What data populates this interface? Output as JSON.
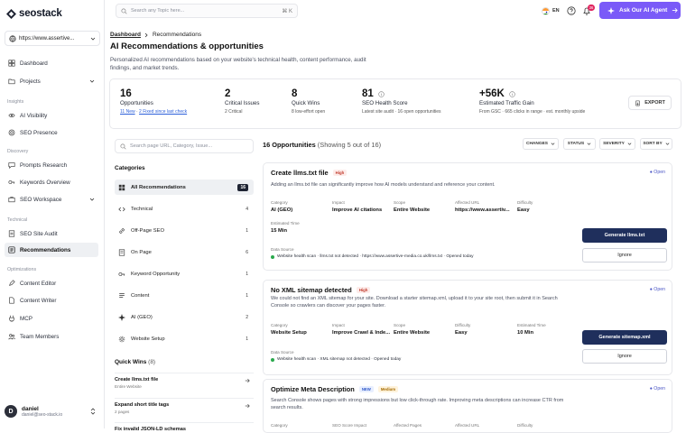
{
  "app": {
    "logo_text": "seostack"
  },
  "sidebar": {
    "site": "https://www.assertive...",
    "items": {
      "dashboard": "Dashboard",
      "projects": "Projects",
      "insights_label": "Insights",
      "ai_visibility": "AI Visibility",
      "seo_presence": "SEO Presence",
      "discovery_label": "Discovery",
      "prompts_research": "Prompts Research",
      "keywords_overview": "Keywords Overview",
      "seo_workspace": "SEO Workspace",
      "technical_label": "Technical",
      "seo_site_audit": "SEO Site Audit",
      "recommendations": "Recommendations",
      "optimizations_label": "Optimizations",
      "content_editor": "Content Editor",
      "content_writer": "Content Writer",
      "mcp": "MCP",
      "team_members": "Team Members"
    },
    "user": {
      "initial": "D",
      "name": "daniel",
      "email": "daniel@seo-stack.io"
    }
  },
  "topbar": {
    "search_placeholder": "Search any Topic here...",
    "shortcut": "⌘ K",
    "lang": "EN",
    "notif_count": "36",
    "ask_label": "Ask Our AI Agent"
  },
  "header": {
    "breadcrumb_root": "Dashboard",
    "breadcrumb_current": "Recommendations",
    "title": "AI Recommendations & opportunities",
    "description": "Personalized AI recommendations based on your website's technical health, content performance, audit findings, and market trends."
  },
  "stats": {
    "opportunities": {
      "value": "16",
      "label": "Opportunities",
      "new": "11 New",
      "fixed": "2 Fixed since last check"
    },
    "critical": {
      "value": "2",
      "label": "Critical Issues",
      "sub": "2 Critical"
    },
    "quick": {
      "value": "8",
      "label": "Quick Wins",
      "sub": "8 low-effort open"
    },
    "health": {
      "value": "81",
      "label": "SEO Health Score",
      "sub": "Latest site audit · 16 open opportunities"
    },
    "traffic": {
      "value": "+56K",
      "label": "Estimated Traffic Gain",
      "sub": "From GSC · 665 clicks in range · est. monthly upside"
    },
    "export_label": "EXPORT"
  },
  "filters": {
    "search_placeholder": "Search page URL, Category, Issue...",
    "categories_title": "Categories",
    "categories": [
      {
        "label": "All Recommendations",
        "count": "16"
      },
      {
        "label": "Technical",
        "count": "4"
      },
      {
        "label": "Off-Page SEO",
        "count": "1"
      },
      {
        "label": "On Page",
        "count": "6"
      },
      {
        "label": "Keyword Opportunity",
        "count": "1"
      },
      {
        "label": "Content",
        "count": "1"
      },
      {
        "label": "AI (GEO)",
        "count": "2"
      },
      {
        "label": "Website Setup",
        "count": "1"
      }
    ],
    "quick_wins_title": "Quick Wins",
    "quick_wins_count": "(8)",
    "quick_wins": [
      {
        "title": "Create llms.txt file",
        "sub": "Entire Website"
      },
      {
        "title": "Expand short title tags",
        "sub": "2 pages"
      },
      {
        "title": "Fix invalid JSON-LD schemas",
        "sub": ""
      }
    ]
  },
  "list": {
    "count_label": "16 Opportunities",
    "showing": "(Showing 5 out of 16)",
    "changes": "CHANGES",
    "status": "STATUS",
    "severity": "SEVERITY",
    "sort": "SORT BY"
  },
  "cards": [
    {
      "title": "Create llms.txt file",
      "badge": "High",
      "status": "Open",
      "description": "Adding an llms.txt file can significantly improve how AI models understand and reference your content.",
      "fields": [
        {
          "k": "Category",
          "v": "AI (GEO)"
        },
        {
          "k": "Impact",
          "v": "Improve AI citations"
        },
        {
          "k": "Scope",
          "v": "Entire Website"
        },
        {
          "k": "Affected URL",
          "v": "https://www.assertiv..."
        },
        {
          "k": "Difficulty",
          "v": "Easy"
        }
      ],
      "time": {
        "k": "Estimated Time",
        "v": "15 Min"
      },
      "source_label": "Data Source",
      "source": "Website health scan · llms.txt not detected · https://www.assertive-media.co.uk/llms.txt · Opened today",
      "primary": "Generate llms.txt",
      "secondary": "Ignore"
    },
    {
      "title": "No XML sitemap detected",
      "badge": "High",
      "status": "Open",
      "description": "We could not find an XML sitemap for your site. Download a starter sitemap.xml, upload it to your site root, then submit it in Search Console so crawlers can discover your pages faster.",
      "fields": [
        {
          "k": "Category",
          "v": "Website Setup"
        },
        {
          "k": "Impact",
          "v": "Improve Crawl & Inde..."
        },
        {
          "k": "Scope",
          "v": "Entire Website"
        },
        {
          "k": "Difficulty",
          "v": "Easy"
        },
        {
          "k": "Estimated Time",
          "v": "10 Min"
        }
      ],
      "source_label": "Data Source",
      "source": "Website health scan · XML sitemap not detected · Opened today",
      "primary": "Generate sitemap.xml",
      "secondary": "Ignore"
    },
    {
      "title": "Optimize Meta Description",
      "badge_new": "NEW",
      "badge": "Medium",
      "status": "Open",
      "description": "Search Console shows pages with strong impressions but low click-through rate. Improving meta descriptions can increase CTR from search results.",
      "fields": [
        {
          "k": "Category",
          "v": ""
        },
        {
          "k": "SEO Score Impact",
          "v": ""
        },
        {
          "k": "Affected Pages",
          "v": ""
        },
        {
          "k": "Affected URL",
          "v": ""
        },
        {
          "k": "Difficulty",
          "v": ""
        }
      ]
    }
  ]
}
